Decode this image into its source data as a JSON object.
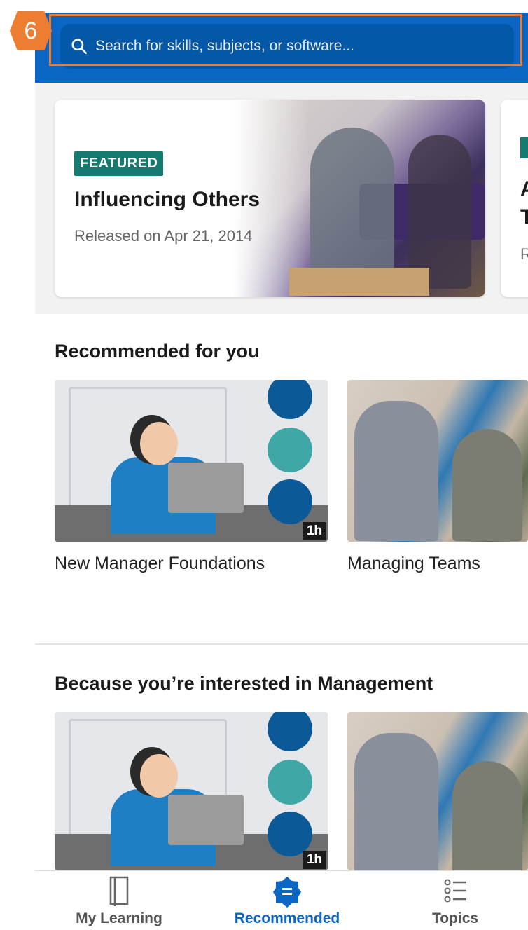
{
  "search": {
    "placeholder": "Search for skills, subjects, or software..."
  },
  "annotation": {
    "step": "6",
    "color": "#ed7d31"
  },
  "featured": [
    {
      "tag": "FEATURED",
      "title": "Influencing Others",
      "subtitle": "Released on Apr 21, 2014"
    },
    {
      "title": "A\nT",
      "subtitle": "R"
    }
  ],
  "sections": [
    {
      "title": "Recommended for you",
      "courses": [
        {
          "name": "New Manager Foundations",
          "duration": "1h"
        },
        {
          "name": "Managing Teams"
        }
      ]
    },
    {
      "title": "Because you’re interested in Management",
      "courses": [
        {
          "duration": "1h"
        },
        {}
      ]
    }
  ],
  "tabs": [
    {
      "label": "My Learning",
      "icon": "book-icon"
    },
    {
      "label": "Recommended",
      "icon": "recommended-badge-icon",
      "active": true
    },
    {
      "label": "Topics",
      "icon": "list-icon"
    }
  ],
  "colors": {
    "brand": "#0a66c2",
    "featured_tag": "#147a6f"
  }
}
